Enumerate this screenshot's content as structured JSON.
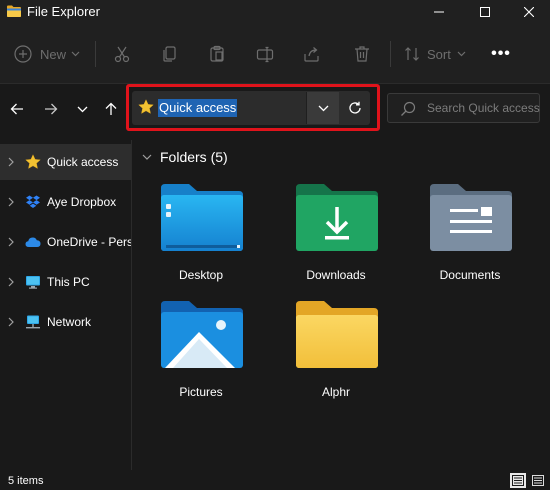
{
  "window": {
    "title": "File Explorer",
    "icons": {
      "app": "folder-icon",
      "minimize": "minimize-icon",
      "maximize": "maximize-icon",
      "close": "close-icon"
    }
  },
  "commandbar": {
    "new_label": "New",
    "sort_label": "Sort",
    "more_label": "•••",
    "icons": [
      "new-plus-icon",
      "cut-icon",
      "copy-icon",
      "paste-icon",
      "rename-icon",
      "share-icon",
      "delete-icon",
      "sort-icon",
      "more-icon"
    ],
    "disabled_color": "#6e6e6e"
  },
  "navigation": {
    "icons": [
      "back-arrow-icon",
      "forward-arrow-icon",
      "recent-chevron-icon",
      "up-arrow-icon"
    ]
  },
  "address": {
    "location": "Quick access",
    "selection_color": "#1f64b3",
    "highlight_color": "#e0131b"
  },
  "search": {
    "placeholder": "Search Quick access"
  },
  "sidebar": {
    "items": [
      {
        "label": "Quick access",
        "icon": "star-icon",
        "selected": true
      },
      {
        "label": "Aye Dropbox",
        "icon": "dropbox-icon",
        "selected": false
      },
      {
        "label": "OneDrive - Pers",
        "icon": "onedrive-cloud-icon",
        "selected": false
      },
      {
        "label": "This PC",
        "icon": "pc-monitor-icon",
        "selected": false
      },
      {
        "label": "Network",
        "icon": "network-icon",
        "selected": false
      }
    ]
  },
  "content": {
    "group_title": "Folders (5)",
    "folders": [
      {
        "label": "Desktop",
        "icon": "desktop-folder-icon",
        "color": "#1aa1e6"
      },
      {
        "label": "Downloads",
        "icon": "downloads-folder-icon",
        "color": "#22a565"
      },
      {
        "label": "Documents",
        "icon": "documents-folder-icon",
        "color": "#7b8ea3"
      },
      {
        "label": "Pictures",
        "icon": "pictures-folder-icon",
        "color": "#1b8fe0"
      },
      {
        "label": "Alphr",
        "icon": "folder-icon",
        "color": "#f5c742"
      }
    ]
  },
  "status": {
    "item_count": "5 items"
  }
}
